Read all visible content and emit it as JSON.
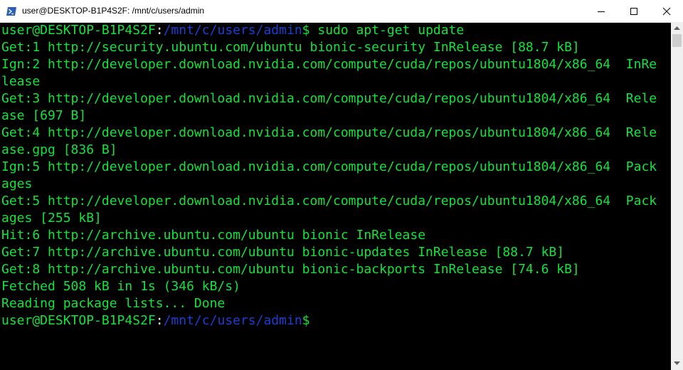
{
  "window": {
    "title": "user@DESKTOP-B1P4S2F: /mnt/c/users/admin",
    "icon": "powershell-icon",
    "buttons": [
      "minimize-icon",
      "maximize-icon",
      "close-icon"
    ]
  },
  "colors": {
    "output": "#13e33a",
    "prompt_user": "#13e33a",
    "prompt_path": "#1c3fd6",
    "background": "#000000"
  },
  "terminal": {
    "prompt1": {
      "user": "user@DESKTOP-B1P4S2F",
      "colon": ":",
      "path": "/mnt/c/users/admin",
      "symbol": "$",
      "command": " sudo apt-get update"
    },
    "lines": [
      "Get:1 http://security.ubuntu.com/ubuntu bionic-security InRelease [88.7 kB]",
      "Ign:2 http://developer.download.nvidia.com/compute/cuda/repos/ubuntu1804/x86_64  InRe",
      "lease",
      "Get:3 http://developer.download.nvidia.com/compute/cuda/repos/ubuntu1804/x86_64  Rele",
      "ase [697 B]",
      "Get:4 http://developer.download.nvidia.com/compute/cuda/repos/ubuntu1804/x86_64  Rele",
      "ase.gpg [836 B]",
      "Ign:5 http://developer.download.nvidia.com/compute/cuda/repos/ubuntu1804/x86_64  Pack",
      "ages",
      "Get:5 http://developer.download.nvidia.com/compute/cuda/repos/ubuntu1804/x86_64  Pack",
      "ages [255 kB]",
      "Hit:6 http://archive.ubuntu.com/ubuntu bionic InRelease",
      "Get:7 http://archive.ubuntu.com/ubuntu bionic-updates InRelease [88.7 kB]",
      "Get:8 http://archive.ubuntu.com/ubuntu bionic-backports InRelease [74.6 kB]",
      "Fetched 508 kB in 1s (346 kB/s)",
      "Reading package lists... Done"
    ],
    "prompt2": {
      "user": "user@DESKTOP-B1P4S2F",
      "colon": ":",
      "path": "/mnt/c/users/admin",
      "symbol": "$",
      "command": ""
    }
  },
  "scrollbar": {
    "position": 0.0
  }
}
